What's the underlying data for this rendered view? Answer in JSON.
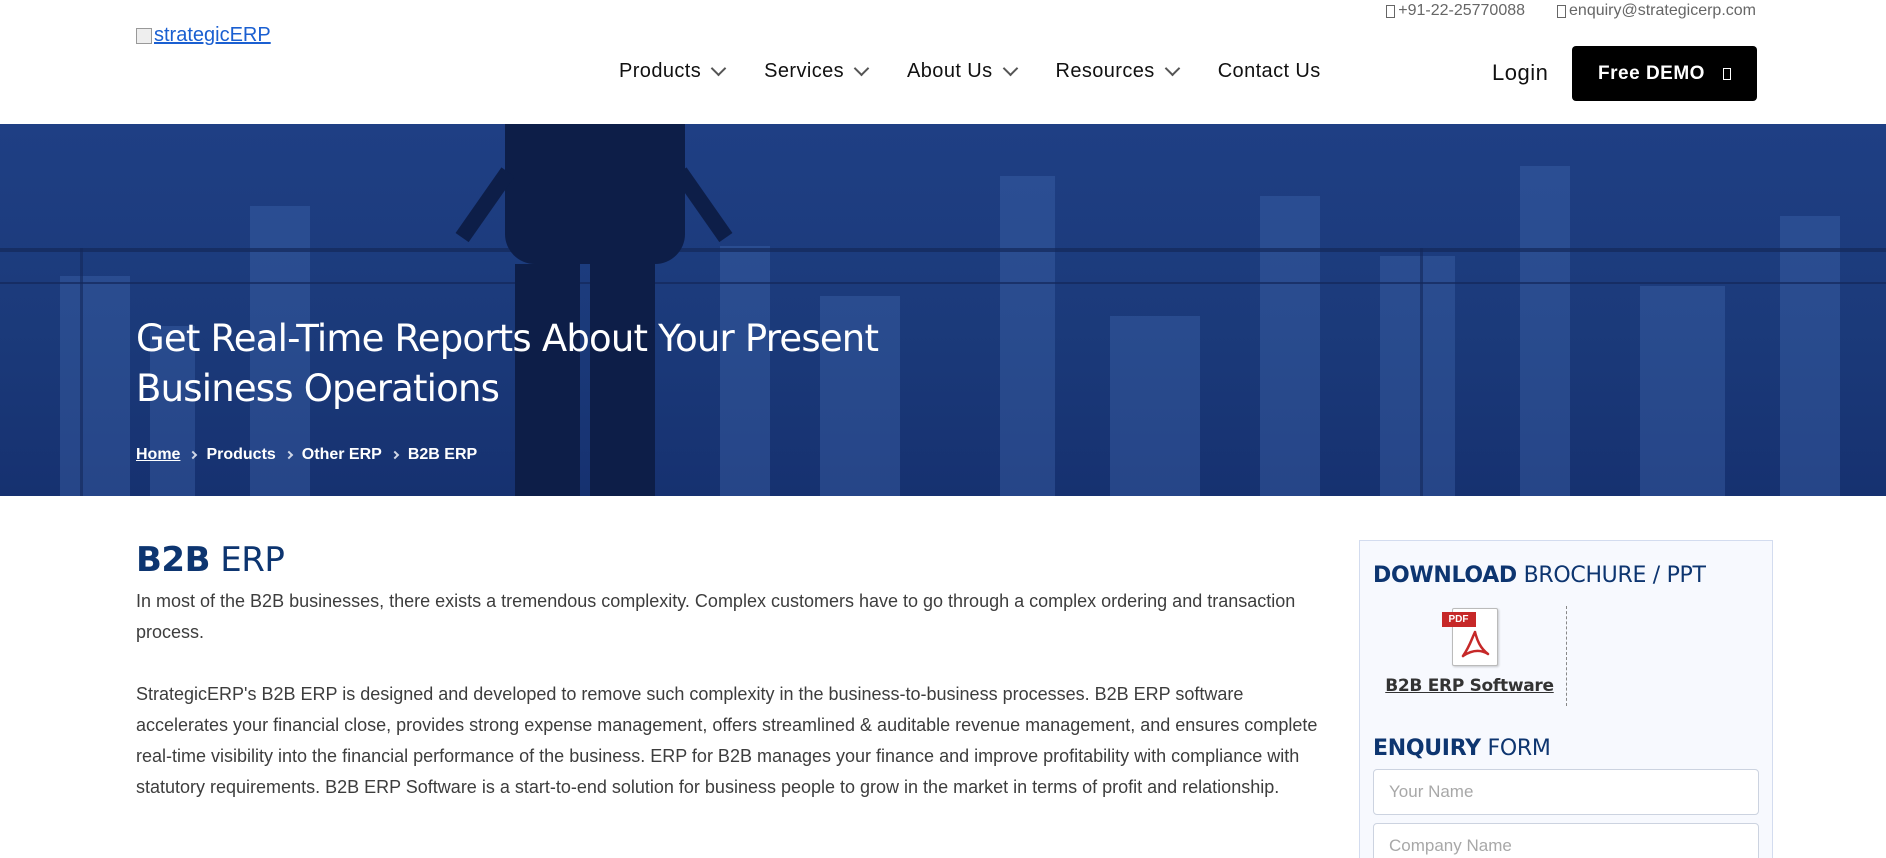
{
  "header": {
    "logo_alt": "strategicERP",
    "phone": "+91-22-25770088",
    "email": "enquiry@strategicerp.com",
    "nav": [
      {
        "label": "Products",
        "has_dropdown": true
      },
      {
        "label": "Services",
        "has_dropdown": true
      },
      {
        "label": "About Us",
        "has_dropdown": true
      },
      {
        "label": "Resources",
        "has_dropdown": true
      },
      {
        "label": "Contact Us",
        "has_dropdown": false
      }
    ],
    "login_label": "Login",
    "demo_label": "Free DEMO"
  },
  "hero": {
    "title": "Get Real-Time Reports About Your Present Business Operations",
    "breadcrumb": [
      "Home",
      "Products",
      "Other ERP",
      "B2B ERP"
    ]
  },
  "main": {
    "title_bold": "B2B",
    "title_rest": " ERP",
    "paragraphs": [
      "In most of the B2B businesses, there exists a tremendous complexity. Complex customers have to go through a complex ordering and transaction process.",
      "StrategicERP's B2B ERP is designed and developed to remove such complexity in the business-to-business processes. B2B ERP software accelerates your financial close, provides strong expense management, offers streamlined & auditable revenue management, and ensures complete real-time visibility into the financial performance of the business. ERP for B2B manages your finance and improve profitability with compliance with statutory requirements. B2B ERP Software is a start-to-end solution for business people to grow in the market in terms of profit and relationship."
    ]
  },
  "sidebar": {
    "download_bold": "DOWNLOAD",
    "download_rest": " BROCHURE / PPT",
    "pdf_tag": "PDF",
    "brochure_label": "B2B ERP Software",
    "enquiry_bold": "ENQUIRY",
    "enquiry_rest": " FORM",
    "fields": {
      "name_placeholder": "Your Name",
      "company_placeholder": "Company Name"
    }
  },
  "colors": {
    "brand_navy": "#0d3570",
    "hero_blue": "#1b3a7a",
    "button_black": "#000000"
  }
}
